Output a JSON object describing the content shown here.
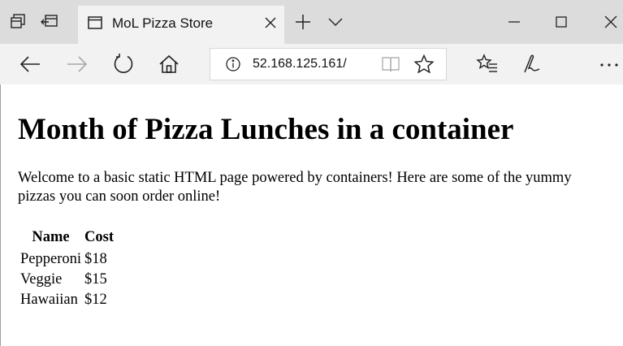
{
  "browser": {
    "tab": {
      "title": "MoL Pizza Store"
    },
    "address_bar": {
      "url": "52.168.125.161/"
    },
    "icons": {
      "set_aside_tabs": "set-aside-tabs-icon",
      "restore_tabs": "restore-tabs-icon",
      "page": "page-icon",
      "close_tab": "close-icon",
      "new_tab": "plus-icon",
      "tab_list": "chevron-down-icon",
      "minimize": "minimize-icon",
      "maximize": "maximize-icon",
      "close_window": "close-icon",
      "back": "back-arrow-icon",
      "forward": "forward-arrow-icon",
      "refresh": "refresh-icon",
      "home": "home-icon",
      "site_info": "info-icon",
      "reading_view": "book-icon",
      "favorite": "star-icon",
      "favorites_hub": "favorites-list-icon",
      "web_note": "pen-icon",
      "more": "more-icon"
    }
  },
  "page": {
    "heading": "Month of Pizza Lunches in a container",
    "intro": "Welcome to a basic static HTML page powered by containers! Here are some of the yummy pizzas you can soon order online!",
    "table": {
      "headers": [
        "Name",
        "Cost"
      ],
      "rows": [
        [
          "Pepperoni",
          "$18"
        ],
        [
          "Veggie",
          "$15"
        ],
        [
          "Hawaiian",
          "$12"
        ]
      ]
    }
  }
}
